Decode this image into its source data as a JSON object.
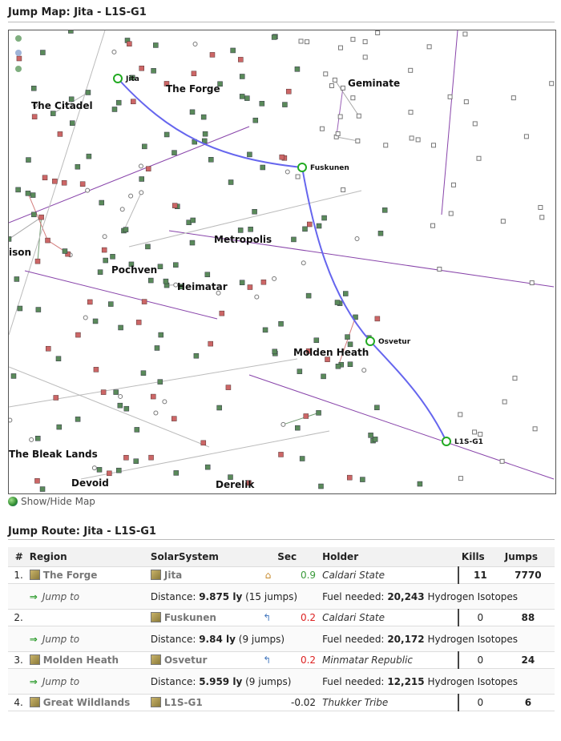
{
  "map_title": "Jump Map: Jita - L1S-G1",
  "route_title": "Jump Route: Jita - L1S-G1",
  "toggle_label": "Show/Hide Map",
  "map": {
    "regions": [
      "The Forge",
      "The Citadel",
      "Geminate",
      "ison",
      "Pochven",
      "Metropolis",
      "Heimatar",
      "Molden Heath",
      "The Bleak Lands",
      "Devoid",
      "Derelik"
    ],
    "route_systems": [
      "Jita",
      "Fuskunen",
      "Osvetur",
      "L1S-G1"
    ],
    "route_color": "#6666ee",
    "highsec_color": "#5a8a5a",
    "lowsec_color": "#cc6666",
    "jumpbridge_color": "#8844aa"
  },
  "table": {
    "headers": {
      "num": "#",
      "region": "Region",
      "system": "SolarSystem",
      "sec": "Sec",
      "holder": "Holder",
      "kills": "Kills",
      "jumps": "Jumps"
    },
    "rows": [
      {
        "num": "1.",
        "region": "The Forge",
        "system": "Jita",
        "icon": "home-icon",
        "sec": "0.9",
        "holder": "Caldari State",
        "kills": "11",
        "jumps": "7770"
      },
      {
        "num": "2.",
        "region": "",
        "system": "Fuskunen",
        "icon": "jump-icon",
        "sec": "0.2",
        "holder": "Caldari State",
        "kills": "0",
        "jumps": "88"
      },
      {
        "num": "3.",
        "region": "Molden Heath",
        "system": "Osvetur",
        "icon": "jump-icon",
        "sec": "0.2",
        "holder": "Minmatar Republic",
        "kills": "0",
        "jumps": "24"
      },
      {
        "num": "4.",
        "region": "Great Wildlands",
        "system": "L1S-G1",
        "icon": "",
        "sec": "-0.02",
        "holder": "Thukker Tribe",
        "kills": "0",
        "jumps": "6"
      }
    ],
    "jumps": [
      {
        "label": "Jump to",
        "distance_prefix": "Distance:",
        "distance": "9.875 ly",
        "jumps": "(15 jumps)",
        "fuel_prefix": "Fuel needed:",
        "fuel": "20,243",
        "fuel_type": "Hydrogen Isotopes"
      },
      {
        "label": "Jump to",
        "distance_prefix": "Distance:",
        "distance": "9.84 ly",
        "jumps": "(9 jumps)",
        "fuel_prefix": "Fuel needed:",
        "fuel": "20,172",
        "fuel_type": "Hydrogen Isotopes"
      },
      {
        "label": "Jump to",
        "distance_prefix": "Distance:",
        "distance": "5.959 ly",
        "jumps": "(9 jumps)",
        "fuel_prefix": "Fuel needed:",
        "fuel": "12,215",
        "fuel_type": "Hydrogen Isotopes"
      }
    ]
  }
}
